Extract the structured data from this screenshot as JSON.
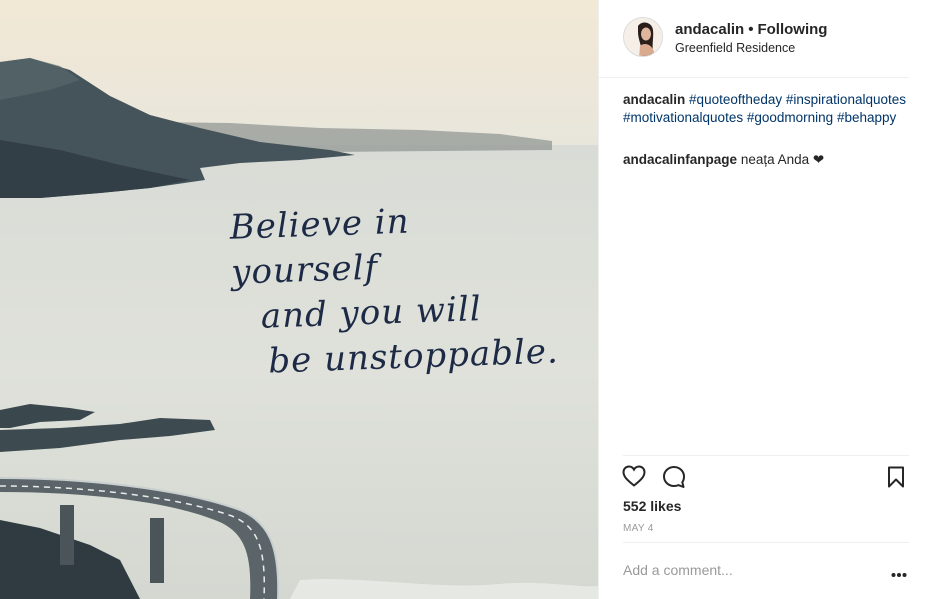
{
  "post": {
    "image": {
      "quote_lines": [
        "Believe in yourself",
        "and you will",
        "be unstoppable."
      ]
    },
    "header": {
      "username": "andacalin",
      "separator": "•",
      "follow_status": "Following",
      "location": "Greenfield Residence"
    },
    "caption": {
      "username": "andacalin",
      "hashtags": [
        "#quoteoftheday",
        "#inspirationalquotes",
        "#motivationalquotes",
        "#goodmorning",
        "#behappy"
      ]
    },
    "comments": [
      {
        "username": "andacalinfanpage",
        "text": "neața Anda ❤"
      }
    ],
    "actions": {
      "icons": [
        "heart-icon",
        "comment-icon",
        "bookmark-icon"
      ]
    },
    "likes": "552 likes",
    "date": "MAY 4",
    "comment_box": {
      "placeholder": "Add a comment...",
      "more_icon": "more-options-icon"
    },
    "colors": {
      "text": "#262626",
      "hashtag": "#003569",
      "muted": "#999999",
      "quote_ink": "#1d2a45"
    }
  }
}
